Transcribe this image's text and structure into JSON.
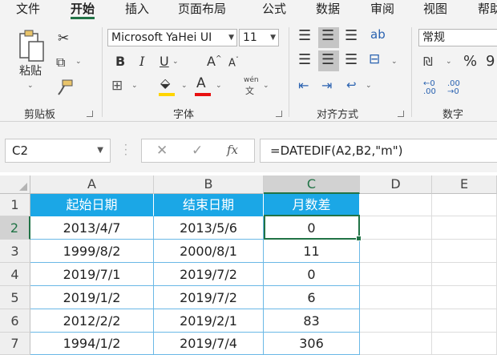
{
  "menu": {
    "tabs": [
      {
        "label": "文件",
        "active": false
      },
      {
        "label": "开始",
        "active": true
      },
      {
        "label": "插入",
        "active": false
      },
      {
        "label": "页面布局",
        "active": false
      },
      {
        "label": "公式",
        "active": false
      },
      {
        "label": "数据",
        "active": false
      },
      {
        "label": "审阅",
        "active": false
      },
      {
        "label": "视图",
        "active": false
      },
      {
        "label": "帮助",
        "active": false
      }
    ]
  },
  "ribbon": {
    "clipboard": {
      "label": "剪贴板",
      "paste_label": "粘贴"
    },
    "font": {
      "label": "字体",
      "font_name": "Microsoft YaHei UI",
      "font_size": "11",
      "bold": "B",
      "italic": "I",
      "underline": "U",
      "grow": "A",
      "shrink": "A",
      "font_color_letter": "A",
      "phonetic_top": "wén",
      "phonetic_bottom": "文",
      "fill_color": "#ffd500",
      "font_color": "#e81010"
    },
    "alignment": {
      "label": "对齐方式"
    },
    "number": {
      "label": "数字",
      "format": "常规",
      "percent": "%",
      "comma": "9"
    }
  },
  "formula_bar": {
    "name_box": "C2",
    "fx": "fx",
    "formula": "=DATEDIF(A2,B2,\"m\")"
  },
  "sheet": {
    "columns": [
      "A",
      "B",
      "C",
      "D",
      "E"
    ],
    "rows": [
      "1",
      "2",
      "3",
      "4",
      "5",
      "6",
      "7"
    ],
    "selected_column": "C",
    "selected_row": "2",
    "header_color": "#1ba7e6",
    "accent_color": "#217346",
    "header": [
      "起始日期",
      "结束日期",
      "月数差"
    ],
    "data": [
      [
        "2013/4/7",
        "2013/5/6",
        "0"
      ],
      [
        "1999/8/2",
        "2000/8/1",
        "11"
      ],
      [
        "2019/7/1",
        "2019/7/2",
        "0"
      ],
      [
        "2019/1/2",
        "2019/7/2",
        "6"
      ],
      [
        "2012/2/2",
        "2019/2/1",
        "83"
      ],
      [
        "1994/1/2",
        "2019/7/4",
        "306"
      ]
    ]
  }
}
